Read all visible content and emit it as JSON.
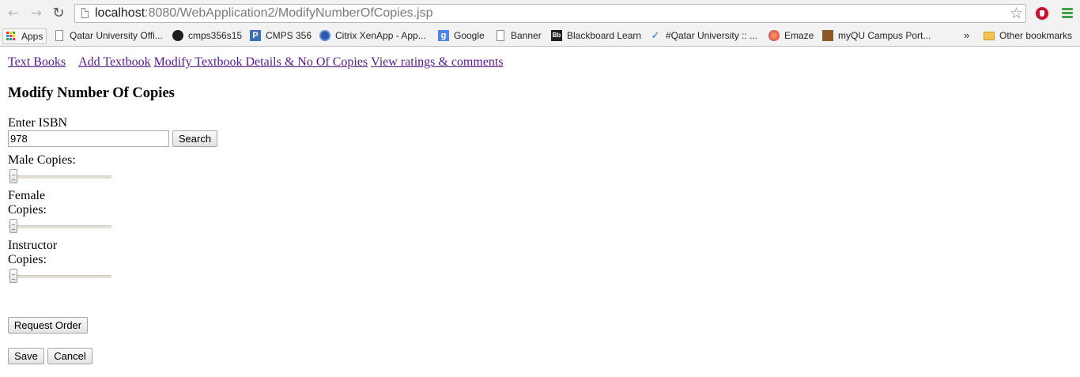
{
  "browser": {
    "url_host": "localhost",
    "url_rest": ":8080/WebApplication2/ModifyNumberOfCopies.jsp",
    "bookmarks": [
      {
        "label": "Apps",
        "icon": "apps-grid-icon"
      },
      {
        "label": "Qatar University Offi...",
        "icon": "page-icon"
      },
      {
        "label": "cmps356s15",
        "icon": "github-icon"
      },
      {
        "label": "CMPS 356",
        "icon": "p-icon"
      },
      {
        "label": "Citrix XenApp - App...",
        "icon": "citrix-icon"
      },
      {
        "label": "Google",
        "icon": "google-icon"
      },
      {
        "label": "Banner",
        "icon": "page-icon"
      },
      {
        "label": "Blackboard Learn",
        "icon": "blackboard-icon"
      },
      {
        "label": "#Qatar University :: ...",
        "icon": "qu-icon"
      },
      {
        "label": "Emaze",
        "icon": "emaze-icon"
      },
      {
        "label": "myQU Campus Port...",
        "icon": "myqu-icon"
      }
    ],
    "overflow_chevron": "»",
    "other_bookmarks": "Other bookmarks"
  },
  "nav": {
    "links": [
      "Text Books",
      "Add Textbook",
      "Modify Textbook Details & No Of Copies",
      "View ratings & comments"
    ]
  },
  "page": {
    "title": "Modify Number Of Copies",
    "isbn_label": "Enter ISBN",
    "isbn_value": "978",
    "search_button": "Search",
    "male_label": "Male Copies:",
    "female_label_1": "Female",
    "female_label_2": "Copies:",
    "instructor_label_1": "Instructor",
    "instructor_label_2": "Copies:",
    "sliders": {
      "male": 0,
      "female": 0,
      "instructor": 0
    },
    "request_order_button": "Request Order",
    "save_button": "Save",
    "cancel_button": "Cancel"
  },
  "colors": {
    "visited_link": "#551a8b",
    "menu_icon": "#43a047",
    "extension_icon": "#c8102e"
  }
}
